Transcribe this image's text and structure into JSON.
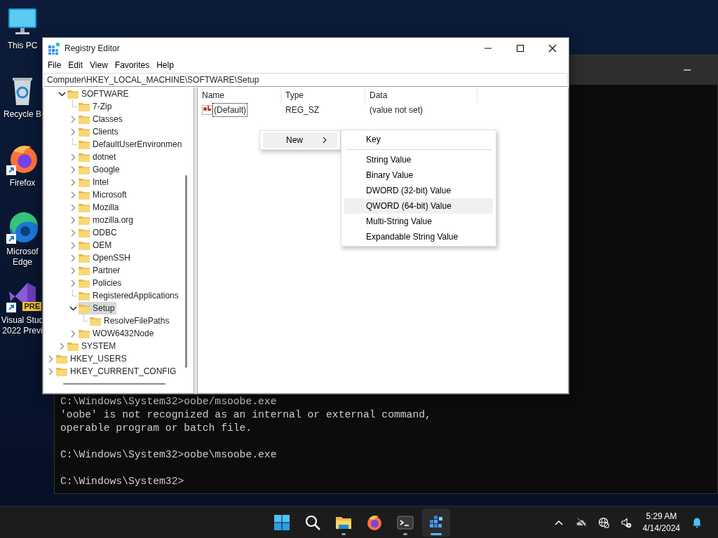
{
  "desktop_icons": [
    {
      "kind": "pc",
      "shortcut": false,
      "lines": [
        "This PC"
      ]
    },
    {
      "kind": "recycle",
      "shortcut": false,
      "lines": [
        "Recycle B"
      ]
    },
    {
      "kind": "firefox",
      "shortcut": true,
      "lines": [
        "Firefox"
      ]
    },
    {
      "kind": "edge",
      "shortcut": true,
      "lines": [
        "Microsof",
        "Edge"
      ]
    },
    {
      "kind": "vs",
      "shortcut": true,
      "badge": "PRE",
      "lines": [
        "Visual Stud",
        "2022 Previ"
      ]
    }
  ],
  "console": {
    "blocks": [
      [
        "C:\\Windows\\System32>oobe/msoobe.exe",
        "'oobe' is not recognized as an internal or external command,",
        "operable program or batch file."
      ],
      [
        "C:\\Windows\\System32>oobe\\msoobe.exe"
      ],
      [
        "C:\\Windows\\System32>"
      ]
    ]
  },
  "registry_editor": {
    "title": "Registry Editor",
    "menu": [
      "File",
      "Edit",
      "View",
      "Favorites",
      "Help"
    ],
    "address": "Computer\\HKEY_LOCAL_MACHINE\\SOFTWARE\\Setup",
    "tree": {
      "scrolled_nodes": [
        {
          "label": "SOFTWARE",
          "expandable": true,
          "expanded": true,
          "selected": false,
          "children": [
            {
              "label": "7-Zip",
              "expandable": false,
              "selected": false
            },
            {
              "label": "Classes",
              "expandable": true,
              "expanded": false,
              "selected": false
            },
            {
              "label": "Clients",
              "expandable": true,
              "expanded": false,
              "selected": false
            },
            {
              "label": "DefaultUserEnvironmen",
              "expandable": false,
              "selected": false
            },
            {
              "label": "dotnet",
              "expandable": true,
              "expanded": false,
              "selected": false
            },
            {
              "label": "Google",
              "expandable": true,
              "expanded": false,
              "selected": false
            },
            {
              "label": "Intel",
              "expandable": true,
              "expanded": false,
              "selected": false
            },
            {
              "label": "Microsoft",
              "expandable": true,
              "expanded": false,
              "selected": false
            },
            {
              "label": "Mozilla",
              "expandable": true,
              "expanded": false,
              "selected": false
            },
            {
              "label": "mozilla.org",
              "expandable": true,
              "expanded": false,
              "selected": false
            },
            {
              "label": "ODBC",
              "expandable": true,
              "expanded": false,
              "selected": false
            },
            {
              "label": "OEM",
              "expandable": true,
              "expanded": false,
              "selected": false
            },
            {
              "label": "OpenSSH",
              "expandable": true,
              "expanded": false,
              "selected": false
            },
            {
              "label": "Partner",
              "expandable": true,
              "expanded": false,
              "selected": false
            },
            {
              "label": "Policies",
              "expandable": true,
              "expanded": false,
              "selected": false
            },
            {
              "label": "RegisteredApplications",
              "expandable": false,
              "selected": false
            },
            {
              "label": "Setup",
              "expandable": true,
              "expanded": true,
              "selected": true,
              "children": [
                {
                  "label": "ResolveFilePaths",
                  "expandable": false,
                  "selected": false
                }
              ]
            },
            {
              "label": "WOW6432Node",
              "expandable": true,
              "expanded": false,
              "selected": false
            }
          ]
        },
        {
          "label": "SYSTEM",
          "expandable": true,
          "expanded": false,
          "selected": false
        }
      ],
      "root_nodes": [
        {
          "label": "HKEY_USERS",
          "expandable": true,
          "expanded": false,
          "selected": false
        },
        {
          "label": "HKEY_CURRENT_CONFIG",
          "expandable": true,
          "expanded": false,
          "selected": false
        }
      ]
    },
    "columns": [
      "Name",
      "Type",
      "Data"
    ],
    "values": [
      {
        "name": "(Default)",
        "type": "REG_SZ",
        "data": "(value not set)",
        "focused": true
      }
    ]
  },
  "context_menu": {
    "items": [
      {
        "label": "New",
        "submenu": true,
        "highlighted": true
      }
    ]
  },
  "submenu": {
    "groups": [
      [
        {
          "label": "Key",
          "highlighted": false
        }
      ],
      [
        {
          "label": "String Value",
          "highlighted": false
        },
        {
          "label": "Binary Value",
          "highlighted": false
        },
        {
          "label": "DWORD (32-bit) Value",
          "highlighted": false
        },
        {
          "label": "QWORD (64-bit) Value",
          "highlighted": true
        },
        {
          "label": "Multi-String Value",
          "highlighted": false
        },
        {
          "label": "Expandable String Value",
          "highlighted": false
        }
      ]
    ]
  },
  "taskbar": {
    "apps": [
      {
        "kind": "start",
        "running": false,
        "active": false
      },
      {
        "kind": "search",
        "running": false,
        "active": false
      },
      {
        "kind": "explorer",
        "running": true,
        "active": false
      },
      {
        "kind": "firefox",
        "running": false,
        "active": false
      },
      {
        "kind": "terminal",
        "running": true,
        "active": false
      },
      {
        "kind": "regedit",
        "running": true,
        "active": true
      }
    ],
    "tray_icons": [
      {
        "kind": "chevron"
      },
      {
        "kind": "cloud-off"
      },
      {
        "kind": "network"
      },
      {
        "kind": "volume-muted"
      }
    ],
    "time": "5:29 AM",
    "date": "4/14/2024"
  }
}
